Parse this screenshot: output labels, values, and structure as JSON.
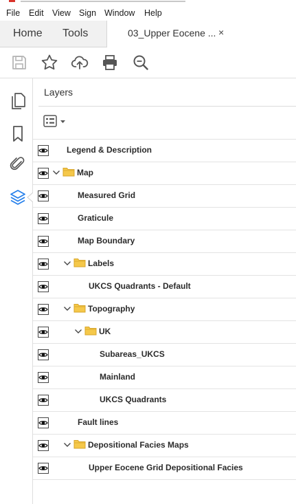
{
  "menu": [
    "File",
    "Edit",
    "View",
    "Sign",
    "Window",
    "Help"
  ],
  "tabs": {
    "home": "Home",
    "tools": "Tools",
    "document": "03_Upper Eocene ...",
    "close": "×"
  },
  "toolbar_icons": [
    "save-icon",
    "star-icon",
    "upload-cloud-icon",
    "print-icon",
    "zoom-search-icon"
  ],
  "rail_icons": [
    "pages-icon",
    "bookmark-icon",
    "paperclip-icon",
    "layers-icon"
  ],
  "colors": {
    "accent": "#2680eb",
    "folder": "#f5c84a",
    "folder_dark": "#d7a52a"
  },
  "panel": {
    "title": "Layers"
  },
  "layers": [
    {
      "name": "Legend & Description",
      "indent": 0,
      "folder": false,
      "expanded": false
    },
    {
      "name": "Map",
      "indent": 0,
      "folder": true,
      "expanded": true
    },
    {
      "name": "Measured Grid",
      "indent": 1,
      "folder": false,
      "expanded": false
    },
    {
      "name": "Graticule",
      "indent": 1,
      "folder": false,
      "expanded": false
    },
    {
      "name": "Map Boundary",
      "indent": 1,
      "folder": false,
      "expanded": false
    },
    {
      "name": "Labels",
      "indent": 1,
      "folder": true,
      "expanded": true
    },
    {
      "name": "UKCS Quadrants - Default",
      "indent": 2,
      "folder": false,
      "expanded": false
    },
    {
      "name": "Topography",
      "indent": 1,
      "folder": true,
      "expanded": true
    },
    {
      "name": "UK",
      "indent": 2,
      "folder": true,
      "expanded": true
    },
    {
      "name": "Subareas_UKCS",
      "indent": 3,
      "folder": false,
      "expanded": false
    },
    {
      "name": "Mainland",
      "indent": 3,
      "folder": false,
      "expanded": false
    },
    {
      "name": "UKCS Quadrants",
      "indent": 3,
      "folder": false,
      "expanded": false
    },
    {
      "name": "Fault lines",
      "indent": 1,
      "folder": false,
      "expanded": false
    },
    {
      "name": "Depositional Facies Maps",
      "indent": 1,
      "folder": true,
      "expanded": true
    },
    {
      "name": "Upper Eocene Grid Depositional Facies",
      "indent": 2,
      "folder": false,
      "expanded": false
    }
  ]
}
